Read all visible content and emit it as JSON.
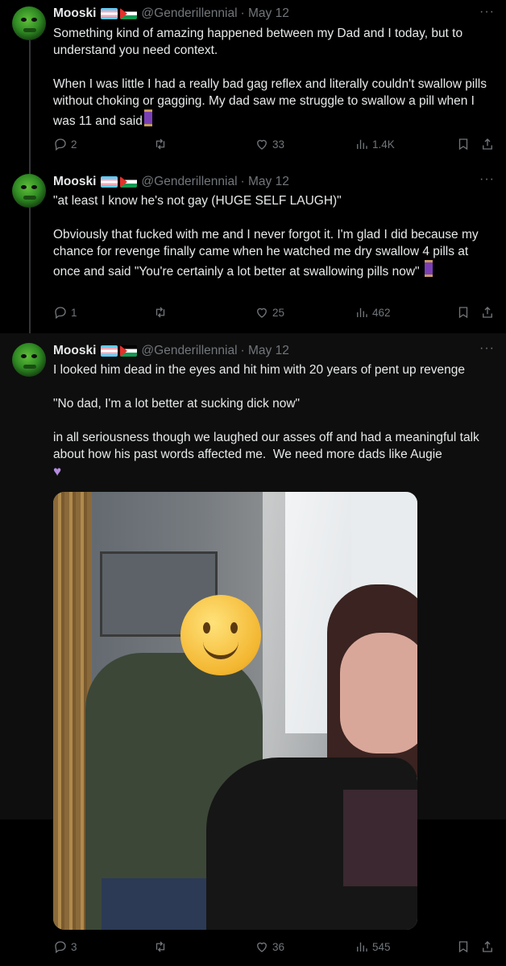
{
  "tweets": [
    {
      "author": {
        "name": "Mooski",
        "handle": "@Genderillennial",
        "date": "· May 12",
        "flags": [
          "transgender-flag",
          "palestine-flag"
        ]
      },
      "text": "Something kind of amazing happened between my Dad and I today, but to understand you need context.\n\nWhen I was little I had a really bad gag reflex and literally couldn't swallow pills without choking or gagging. My dad saw me struggle to swallow a pill when I was 11 and said",
      "emoji": "thread-spool",
      "stats": {
        "replies": "2",
        "retweets": "",
        "likes": "33",
        "views": "1.4K"
      }
    },
    {
      "author": {
        "name": "Mooski",
        "handle": "@Genderillennial",
        "date": "· May 12",
        "flags": [
          "transgender-flag",
          "palestine-flag"
        ]
      },
      "text": "\"at least I know he's not gay (HUGE SELF LAUGH)\"\n\nObviously that fucked with me and I never forgot it. I'm glad I did because my chance for revenge finally came when he watched me dry swallow 4 pills at once and said \"You're certainly a lot better at swallowing pills now\"",
      "emoji": "thread-spool",
      "stats": {
        "replies": "1",
        "retweets": "",
        "likes": "25",
        "views": "462"
      }
    },
    {
      "author": {
        "name": "Mooski",
        "handle": "@Genderillennial",
        "date": "· May 12",
        "flags": [
          "transgender-flag",
          "palestine-flag"
        ]
      },
      "text": "I looked him dead in the eyes and hit him with 20 years of pent up revenge\n\n\"No dad, I'm a lot better at sucking dick now\"\n\nin all seriousness though we laughed our asses off and had a meaningful talk about how his past words affected me.  We need more dads like Augie",
      "emoji": "purple-heart",
      "stats": {
        "replies": "3",
        "retweets": "",
        "likes": "36",
        "views": "545"
      },
      "photo": "photo-of-man-with-smiley-emoji-face-and-woman"
    }
  ],
  "colors": {
    "background": "#000000",
    "text": "#e7e9ea",
    "muted": "#71767b",
    "thread_line": "#333639"
  },
  "icons": [
    "more-icon",
    "reply-icon",
    "retweet-icon",
    "like-icon",
    "views-icon",
    "bookmark-icon",
    "share-icon"
  ]
}
